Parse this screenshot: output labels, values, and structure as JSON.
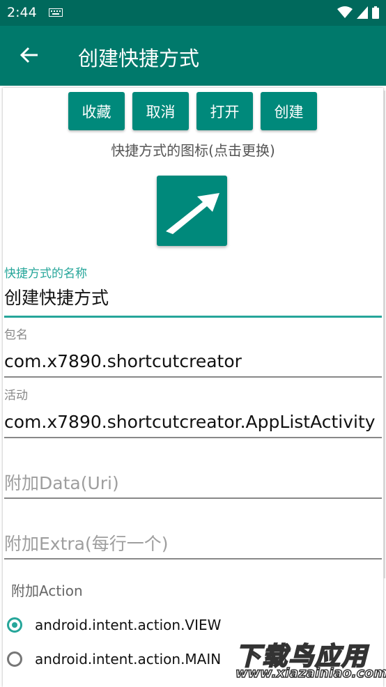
{
  "status_bar": {
    "time": "2:44"
  },
  "app_bar": {
    "title": "创建快捷方式"
  },
  "buttons": {
    "favorite": "收藏",
    "cancel": "取消",
    "open": "打开",
    "create": "创建"
  },
  "icon_caption": "快捷方式的图标(点击更换)",
  "fields": {
    "name": {
      "label": "快捷方式的名称",
      "value": "创建快捷方式"
    },
    "package": {
      "label": "包名",
      "value": "com.x7890.shortcutcreator"
    },
    "activity": {
      "label": "活动",
      "value": "com.x7890.shortcutcreator.AppListActivity"
    },
    "data_uri": {
      "placeholder": "附加Data(Uri)"
    },
    "extra": {
      "placeholder": "附加Extra(每行一个)"
    }
  },
  "action": {
    "label": "附加Action",
    "options": [
      {
        "text": "android.intent.action.VIEW",
        "checked": true
      },
      {
        "text": "android.intent.action.MAIN",
        "checked": false
      }
    ]
  },
  "watermark": {
    "title": "下载鸟应用",
    "url": "www.xiazainiao.com"
  },
  "colors": {
    "primary_dark": "#00695c",
    "primary": "#00796b",
    "accent": "#26a69a",
    "button": "#00897b"
  }
}
